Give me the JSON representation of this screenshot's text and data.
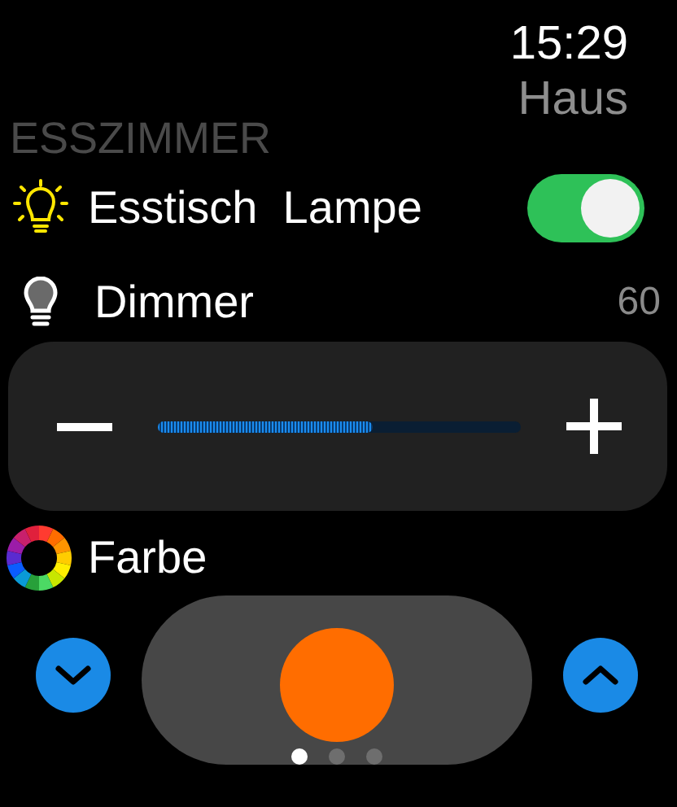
{
  "status": {
    "time": "15:29",
    "app": "Haus"
  },
  "room": {
    "title": "ESSZIMMER"
  },
  "lamp": {
    "label": "Esstisch  Lampe",
    "on": true
  },
  "dimmer": {
    "label": "Dimmer",
    "reading": "60",
    "level": 0.59
  },
  "color": {
    "label": "Farbe",
    "color": "#ff6d00"
  },
  "pages": [
    {
      "selected": true
    },
    {
      "selected": false
    },
    {
      "selected": false
    }
  ]
}
